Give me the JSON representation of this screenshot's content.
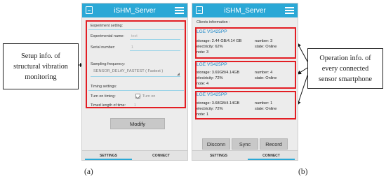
{
  "callout_left": {
    "lines": [
      "Setup info. of",
      "structural vibration",
      "monitoring"
    ]
  },
  "callout_right": {
    "lines": [
      "Operation info. of",
      "every connected",
      "sensor smartphone"
    ]
  },
  "label_a": "(a)",
  "label_b": "(b)",
  "app_title": "iSHM_Server",
  "phone_a": {
    "experiment_setting": "Experiment setting:",
    "experimental_name_label": "Experimental name:",
    "experimental_name_hint": "test",
    "serial_number_label": "Serial number:",
    "serial_number_hint": "1",
    "sampling_frequency_label": "Sampling frequency:",
    "sampling_frequency_value": "SENSOR_DELAY_FASTEST ( Fastest )",
    "timing_settings": "Timing settings:",
    "turn_on_timing_label": "Turn on timing:",
    "turn_on_label": "Turn on",
    "timed_length_label": "Timed length of time:",
    "timed_length_hint": "1",
    "modify_button": "Modify",
    "tabs": [
      "SETTINGS",
      "CONNECT"
    ]
  },
  "phone_b": {
    "clients_header": "Clients information :",
    "clients": [
      {
        "name": "LGE  VS425PP",
        "storage": "storage: 2.44 GB/4.14 GB",
        "number": "number: 3",
        "electricity": "electricity: 62%",
        "state": "state: Online",
        "note": "note: 3"
      },
      {
        "name": "LGE  VS425PP",
        "storage": "storage: 3.69GB/4.14GB",
        "number": "number: 4",
        "electricity": "electricity: 72%",
        "state": "state: Online",
        "note": "note: 4"
      },
      {
        "name": "LGE  VS425PP",
        "storage": "storage: 3.68GB/4.14GB",
        "number": "number: 1",
        "electricity": "electricity: 72%",
        "state": "state: Online",
        "note": "note: 1"
      }
    ],
    "buttons": [
      "Disconn",
      "Sync",
      "Record"
    ],
    "tabs": [
      "SETTINGS",
      "CONNECT"
    ]
  }
}
